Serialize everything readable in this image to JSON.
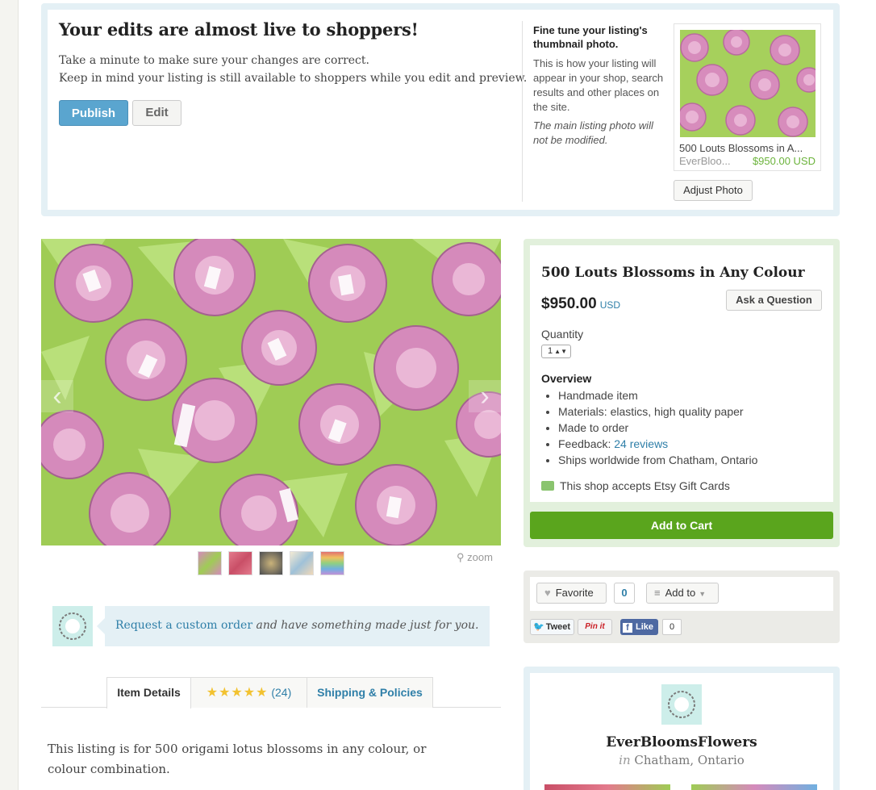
{
  "banner": {
    "title": "Your edits are almost live to shoppers!",
    "line1": "Take a minute to make sure your changes are correct.",
    "line2": "Keep in mind your listing is still available to shoppers while you edit and preview.",
    "publish_label": "Publish",
    "edit_label": "Edit"
  },
  "thumbnail": {
    "heading": "Fine tune your listing's thumbnail photo.",
    "description": "This is how your listing will appear in your shop, search results and other places on the site.",
    "note": "The main listing photo will not be modified.",
    "card_title": "500 Louts Blossoms in A...",
    "card_shop": "EverBloo...",
    "card_price": "$950.00 USD",
    "adjust_label": "Adjust Photo"
  },
  "gallery": {
    "prev_icon": "chevron-left-icon",
    "next_icon": "chevron-right-icon",
    "zoom_label": "zoom",
    "thumbnail_count": 5
  },
  "custom_order": {
    "link_text": "Request a custom order",
    "rest_text": " and have something made just for you."
  },
  "tabs": {
    "item_details": "Item Details",
    "review_count": "(24)",
    "rating_stars": 5,
    "shipping": "Shipping & Policies"
  },
  "description": "This listing is for 500 origami lotus blossoms in any colour, or colour combination.",
  "listing": {
    "title": "500 Louts Blossoms in Any Colour",
    "price": "$950.00",
    "currency": "USD",
    "ask_label": "Ask a Question",
    "quantity_label": "Quantity",
    "quantity_value": "1",
    "overview_label": "Overview",
    "overview": {
      "item1": "Handmade item",
      "item2": "Materials: elastics, high quality paper",
      "item3": "Made to order",
      "feedback_label": "Feedback: ",
      "feedback_link": "24 reviews",
      "item5": "Ships worldwide from Chatham, Ontario"
    },
    "giftcard": "This shop accepts Etsy Gift Cards",
    "add_to_cart": "Add to Cart"
  },
  "social": {
    "favorite_label": "Favorite",
    "favorite_count": "0",
    "add_to_label": "Add to",
    "tweet_label": "Tweet",
    "pin_label": "Pin it",
    "like_label": "Like",
    "like_count": "0"
  },
  "shop": {
    "name": "EverBloomsFlowers",
    "in_label": "in",
    "location": "Chatham, Ontario"
  },
  "colors": {
    "publish": "#5aa5cf",
    "cart": "#5aa51d",
    "link": "#2f7fa8",
    "price_green": "#6bb33b"
  }
}
